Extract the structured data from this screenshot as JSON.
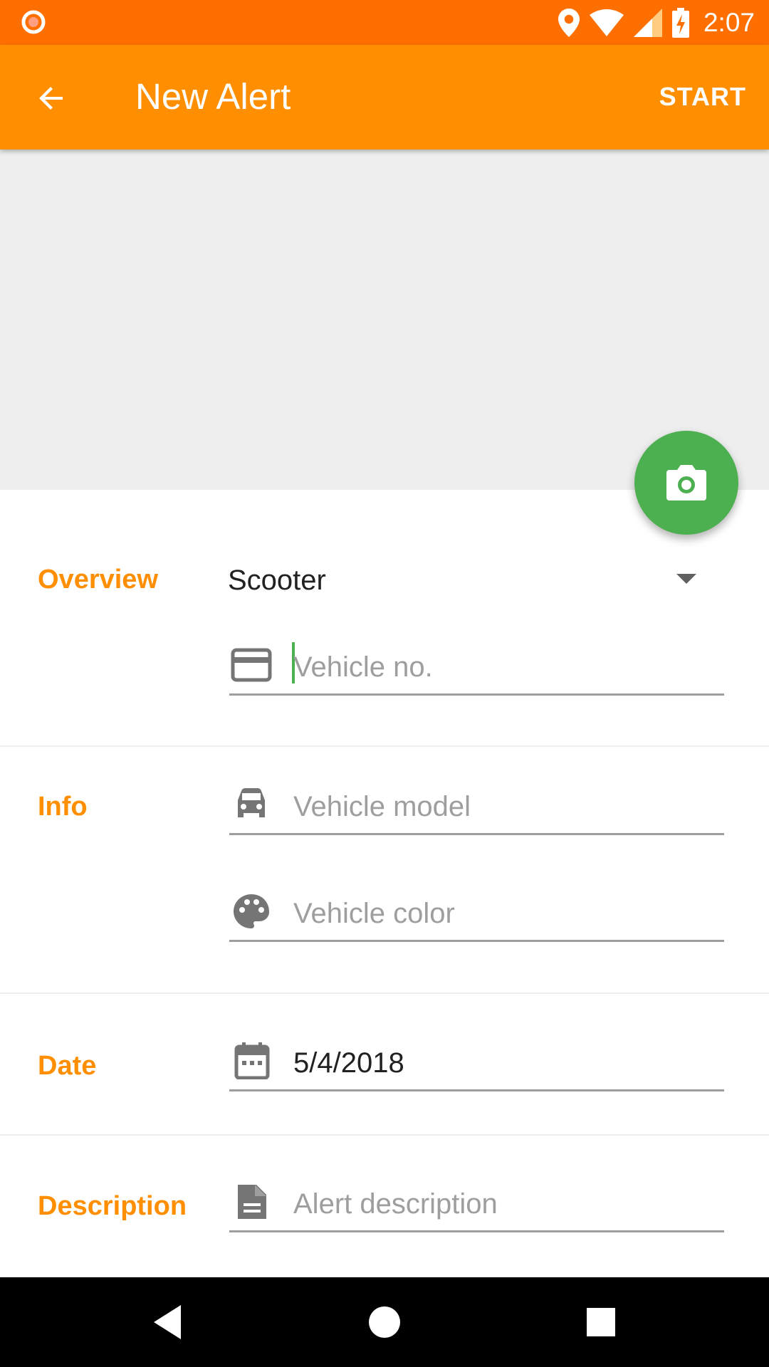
{
  "status_bar": {
    "time": "2:07",
    "icons": [
      "recording-icon",
      "location-icon",
      "wifi-icon",
      "signal-icon",
      "battery-charging-icon"
    ]
  },
  "app_bar": {
    "back_icon": "arrow-back-icon",
    "title": "New Alert",
    "action_label": "START"
  },
  "photo": {
    "fab_icon": "camera-icon",
    "fab_color": "#4caf50"
  },
  "sections": {
    "overview": {
      "label": "Overview",
      "vehicle_type": "Scooter",
      "vehicle_no_placeholder": "Vehicle no.",
      "vehicle_no_value": ""
    },
    "info": {
      "label": "Info",
      "model_placeholder": "Vehicle model",
      "color_placeholder": "Vehicle color"
    },
    "date": {
      "label": "Date",
      "value": "5/4/2018"
    },
    "description": {
      "label": "Description",
      "placeholder": "Alert description"
    }
  },
  "colors": {
    "status_bar": "#ff6f00",
    "app_bar": "#ff8f00",
    "accent": "#ff8f00",
    "fab": "#4caf50"
  },
  "nav_bar": {
    "icons": [
      "back-triangle-icon",
      "home-circle-icon",
      "recents-square-icon"
    ]
  }
}
